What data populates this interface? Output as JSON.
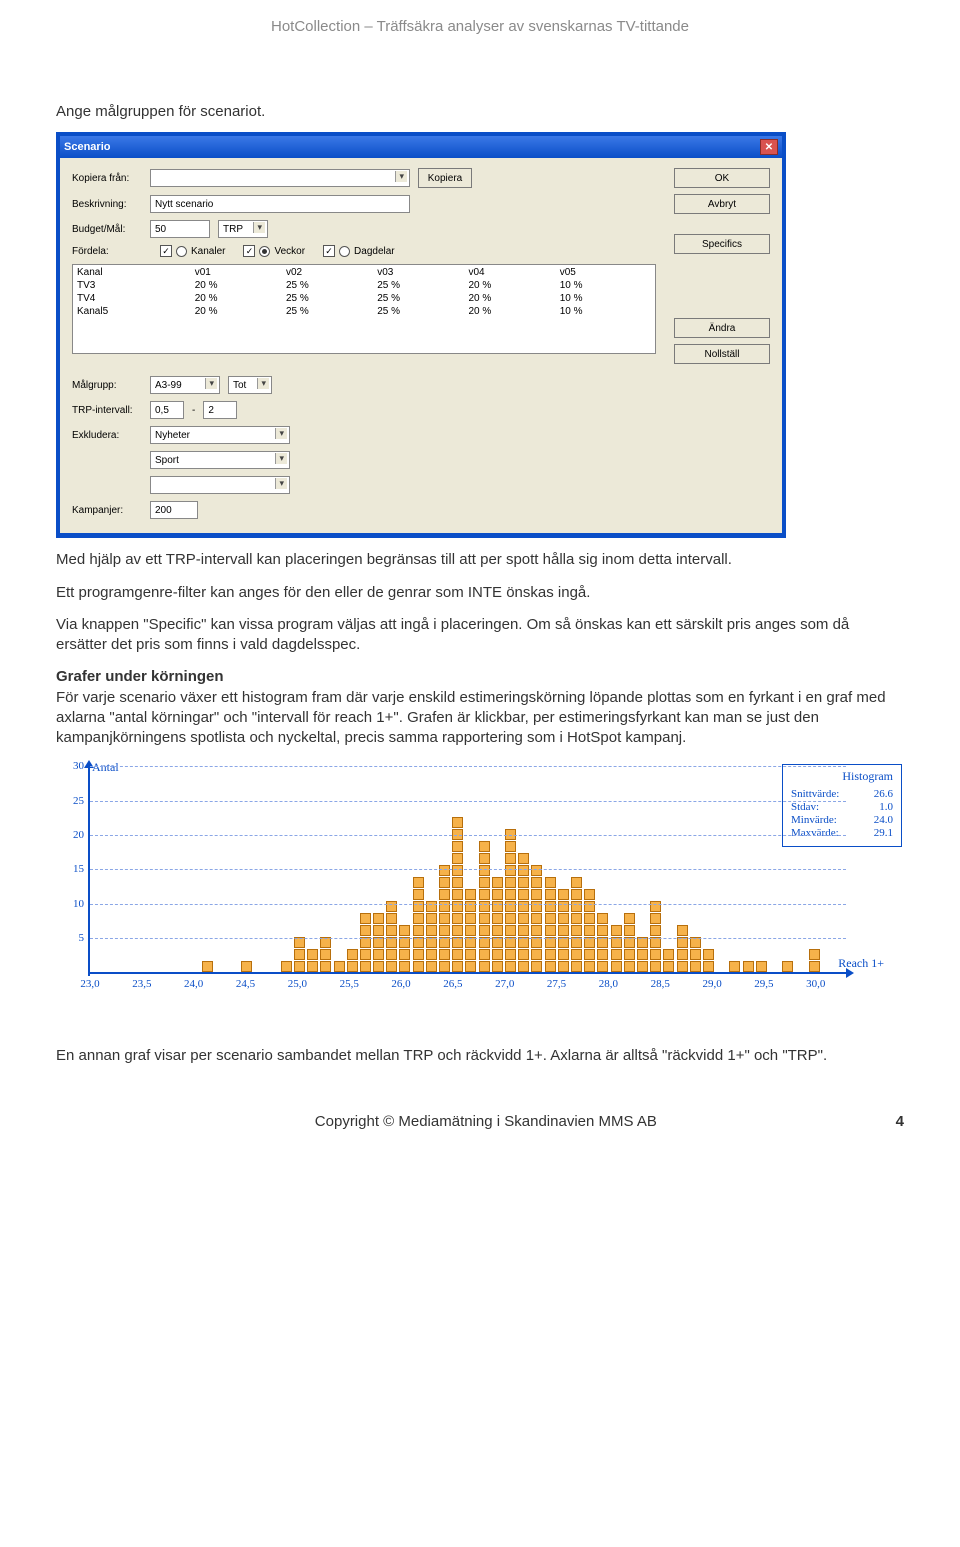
{
  "header": "HotCollection – Träffsäkra analyser av svenskarnas TV-tittande",
  "p1": "Ange målgruppen för scenariot.",
  "p2": "Med hjälp av ett TRP-intervall kan placeringen begränsas till att per spott hålla sig inom detta intervall.",
  "p3": "Ett programgenre-filter kan anges för den eller de genrar som INTE önskas ingå.",
  "p4": "Via knappen \"Specific\" kan vissa program väljas att ingå i placeringen. Om så önskas kan ett särskilt pris anges som då ersätter det pris som finns i vald dagdelsspec.",
  "p5_head": "Grafer under körningen",
  "p5_body": "För varje scenario växer ett histogram fram där varje enskild estimeringskörning löpande plottas som en fyrkant i en graf med axlarna \"antal körningar\" och \"intervall för reach 1+\". Grafen är klickbar, per estimeringsfyrkant kan man se just den kampanjkörningens spotlista och nyckeltal, precis samma rapportering som i HotSpot kampanj.",
  "p6": "En annan graf visar per scenario sambandet mellan TRP och räckvidd 1+. Axlarna är alltså \"räckvidd 1+\" och \"TRP\".",
  "footer_copy": "Copyright © Mediamätning i Skandinavien MMS AB",
  "footer_page": "4",
  "dialog": {
    "title": "Scenario",
    "labels": {
      "kopiera": "Kopiera från:",
      "beskrivning": "Beskrivning:",
      "budget": "Budget/Mål:",
      "fordela": "Fördela:",
      "malgrupp": "Målgrupp:",
      "trp": "TRP-intervall:",
      "exkludera": "Exkludera:",
      "kampanjer": "Kampanjer:"
    },
    "values": {
      "beskrivning": "Nytt scenario",
      "budget": "50",
      "budget_unit": "TRP",
      "malgrupp": "A3-99",
      "malgrupp_scope": "Tot",
      "trp_lo": "0,5",
      "trp_dash": "-",
      "trp_hi": "2",
      "exkl1": "Nyheter",
      "exkl2": "Sport",
      "kampanjer": "200"
    },
    "checks": {
      "kanaler": "Kanaler",
      "veckor": "Veckor",
      "dagdelar": "Dagdelar"
    },
    "buttons": {
      "kopiera": "Kopiera",
      "ok": "OK",
      "avbryt": "Avbryt",
      "specifics": "Specifics",
      "andra": "Ändra",
      "nollstall": "Nollställ"
    },
    "grid": {
      "headers": [
        "Kanal",
        "v01",
        "v02",
        "v03",
        "v04",
        "v05"
      ],
      "rows": [
        [
          "TV3",
          "20 %",
          "25 %",
          "25 %",
          "20 %",
          "10 %"
        ],
        [
          "TV4",
          "20 %",
          "25 %",
          "25 %",
          "20 %",
          "10 %"
        ],
        [
          "Kanal5",
          "20 %",
          "25 %",
          "25 %",
          "20 %",
          "10 %"
        ]
      ]
    }
  },
  "chart_data": {
    "type": "bar",
    "title": "Histogram",
    "ylabel": "Antal",
    "xlabel": "Reach 1+",
    "ylim": [
      0,
      30
    ],
    "yticks": [
      5,
      10,
      15,
      20,
      25,
      30
    ],
    "categories": [
      "23,0",
      "23,5",
      "24,0",
      "24,5",
      "25,0",
      "25,5",
      "26,0",
      "26,5",
      "27,0",
      "27,5",
      "28,0",
      "28,5",
      "29,0",
      "29,5",
      "30,0"
    ],
    "subbin_counts": [
      0,
      0,
      0,
      0,
      0,
      0,
      0,
      0,
      1,
      0,
      0,
      1,
      0,
      0,
      1,
      3,
      2,
      3,
      1,
      2,
      5,
      5,
      6,
      4,
      8,
      6,
      9,
      13,
      7,
      11,
      8,
      12,
      10,
      9,
      8,
      7,
      8,
      7,
      5,
      4,
      5,
      3,
      6,
      2,
      4,
      3,
      2,
      0,
      1,
      1,
      1,
      0,
      1,
      0,
      2
    ],
    "stats": {
      "Snittvärde": "26.6",
      "Stdav": "1.0",
      "Minvärde": "24.0",
      "Maxvärde": "29.1"
    }
  }
}
